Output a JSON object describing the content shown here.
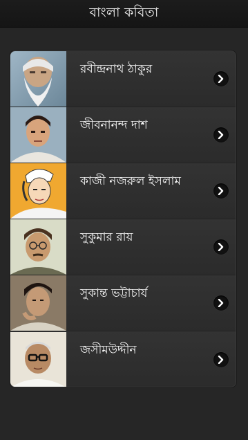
{
  "header": {
    "title": "বাংলা কবিতা"
  },
  "poets": [
    {
      "name": "রবীন্দ্রনাথ ঠাকুর",
      "icon": "portrait-rabindranath"
    },
    {
      "name": "জীবনানন্দ দাশ",
      "icon": "portrait-jibanananda"
    },
    {
      "name": "কাজী নজরুল ইসলাম",
      "icon": "portrait-nazrul"
    },
    {
      "name": "সুকুমার রায়",
      "icon": "portrait-sukumar"
    },
    {
      "name": "সুকান্ত ভট্টাচার্য",
      "icon": "portrait-sukanta"
    },
    {
      "name": "জসীমউদ্দীন",
      "icon": "portrait-jasimuddin"
    }
  ],
  "colors": {
    "background": "#262626",
    "list": "#2e2e2e",
    "text": "#f4f4f4"
  }
}
